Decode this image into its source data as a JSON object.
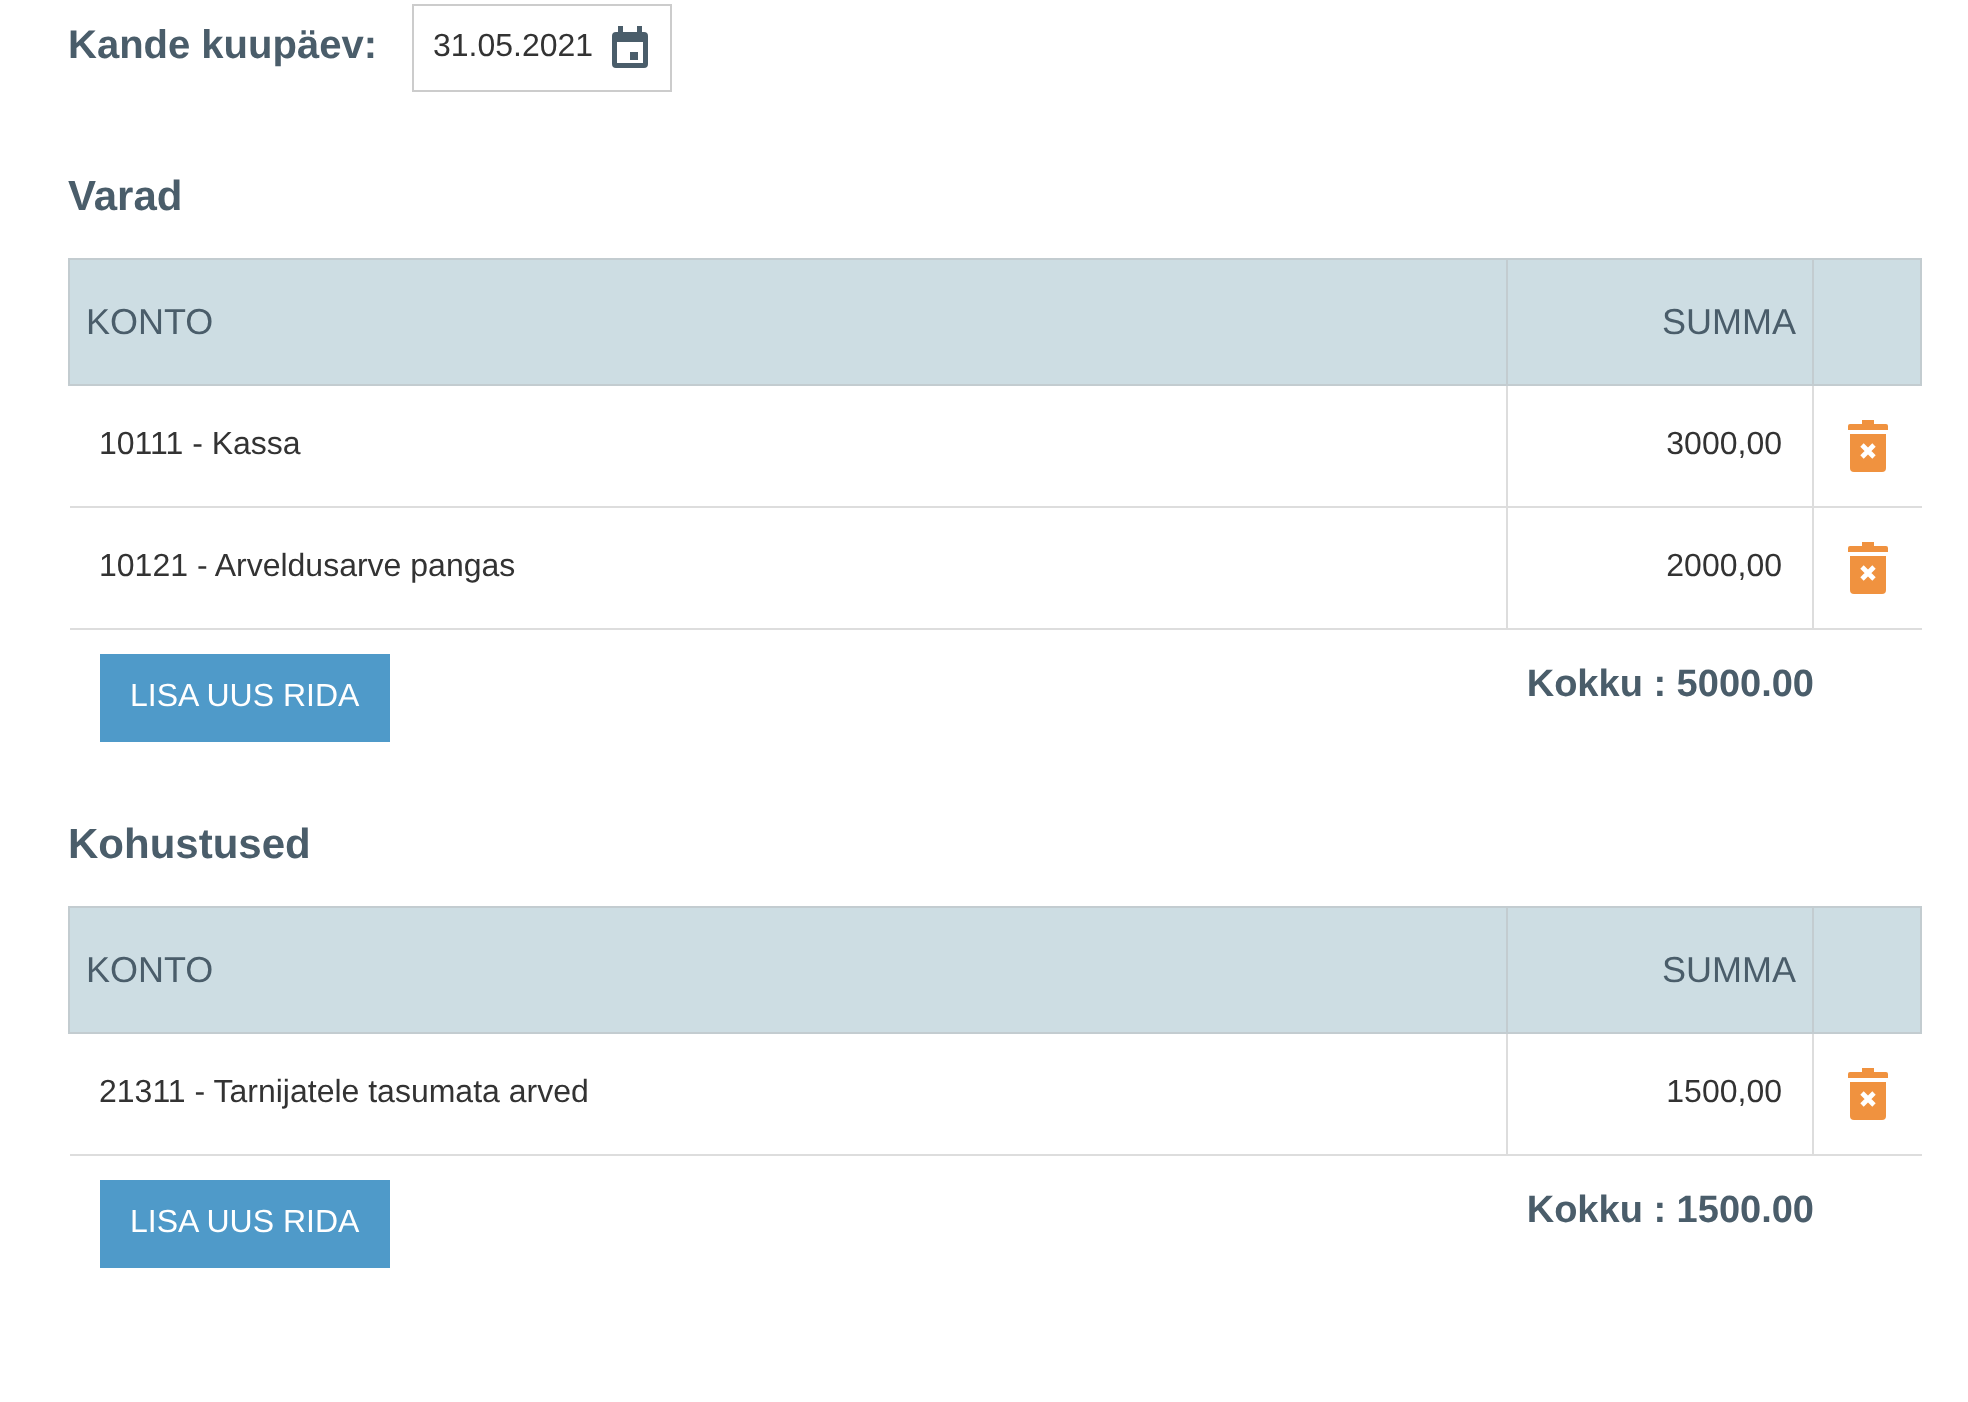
{
  "date_field": {
    "label": "Kande kuupäev:",
    "value": "31.05.2021"
  },
  "sections": [
    {
      "title": "Varad",
      "columns": [
        "KONTO",
        "SUMMA"
      ],
      "rows": [
        {
          "account": "10111 - Kassa",
          "amount": "3000,00"
        },
        {
          "account": "10121 - Arveldusarve pangas",
          "amount": "2000,00"
        }
      ],
      "add_button": "LISA UUS RIDA",
      "total": "Kokku : 5000.00"
    },
    {
      "title": "Kohustused",
      "columns": [
        "KONTO",
        "SUMMA"
      ],
      "rows": [
        {
          "account": "21311 - Tarnijatele tasumata arved",
          "amount": "1500,00"
        }
      ],
      "add_button": "LISA UUS RIDA",
      "total": "Kokku : 1500.00"
    }
  ]
}
